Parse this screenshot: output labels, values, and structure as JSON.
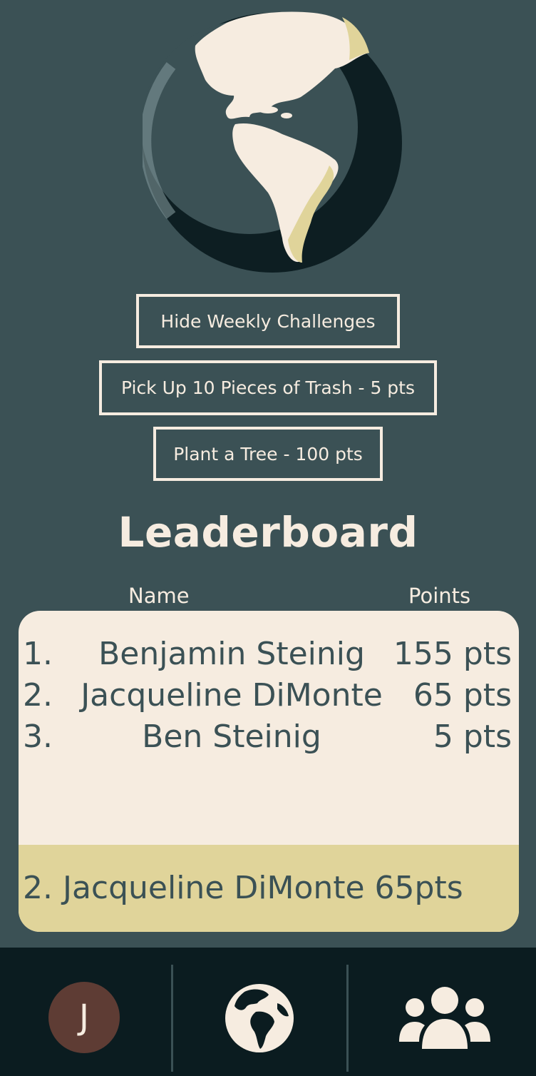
{
  "challenges": {
    "toggle_label": "Hide Weekly Challenges",
    "items": [
      {
        "label": "Pick Up 10 Pieces of Trash - 5 pts"
      },
      {
        "label": "Plant a Tree - 100 pts"
      }
    ]
  },
  "leaderboard": {
    "title": "Leaderboard",
    "columns": {
      "name": "Name",
      "points": "Points"
    },
    "rows": [
      {
        "rank": "1.",
        "name": "Benjamin Steinig",
        "points": "155 pts"
      },
      {
        "rank": "2.",
        "name": "Jacqueline DiMonte",
        "points": "65 pts"
      },
      {
        "rank": "3.",
        "name": "Ben Steinig",
        "points": "5 pts"
      }
    ],
    "current_user": "2. Jacqueline DiMonte 65pts"
  },
  "nav": {
    "avatar_initial": "J",
    "items": [
      "profile",
      "globe-icon",
      "people-group-icon"
    ]
  },
  "colors": {
    "background": "#3b5155",
    "cream": "#f6ece0",
    "highlight": "#e0d49a",
    "navbar": "#0b1c20",
    "avatar": "#5e3c34"
  }
}
